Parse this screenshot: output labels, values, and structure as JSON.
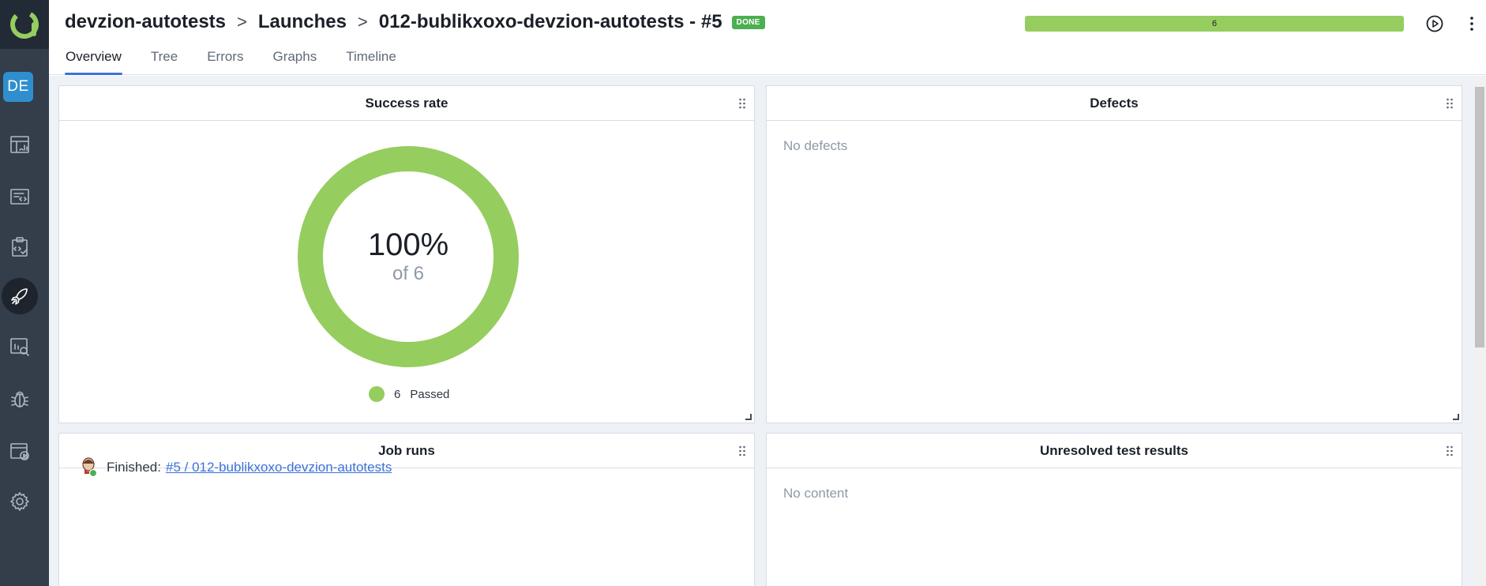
{
  "header": {
    "breadcrumb": {
      "project": "devzion-autotests",
      "section": "Launches",
      "launch": "012-bublikxoxo-devzion-autotests - #5"
    },
    "status": "DONE",
    "progress_label": "6",
    "progress_fraction": 1.0,
    "tabs": [
      "Overview",
      "Tree",
      "Errors",
      "Graphs",
      "Timeline"
    ],
    "active_tab": "Overview"
  },
  "sidebar": {
    "project_badge": "DE",
    "items": [
      {
        "icon": "dashboard-icon"
      },
      {
        "icon": "test-cases-icon"
      },
      {
        "icon": "test-plans-icon"
      },
      {
        "icon": "launches-rocket-icon",
        "active": true
      },
      {
        "icon": "analytics-icon"
      },
      {
        "icon": "defects-bug-icon"
      },
      {
        "icon": "jobs-icon"
      },
      {
        "icon": "settings-gear-icon"
      }
    ]
  },
  "widgets": {
    "success_rate": {
      "title": "Success rate",
      "percent": "100%",
      "of_total": "of 6",
      "legend_count": "6",
      "legend_label": "Passed"
    },
    "defects": {
      "title": "Defects",
      "empty": "No defects"
    },
    "job_runs": {
      "title": "Job runs",
      "status_label": "Finished:",
      "link": "#5 / 012-bublikxoxo-devzion-autotests"
    },
    "unresolved": {
      "title": "Unresolved test results",
      "empty": "No content"
    }
  },
  "colors": {
    "passed": "#96cd5f",
    "sidebar": "#343d4a",
    "accent": "#3d71d9",
    "done_badge": "#4caf50",
    "project_badge": "#2f8fce"
  },
  "chart_data": {
    "type": "pie",
    "categories": [
      "Passed"
    ],
    "values": [
      6
    ],
    "title": "Success rate"
  }
}
